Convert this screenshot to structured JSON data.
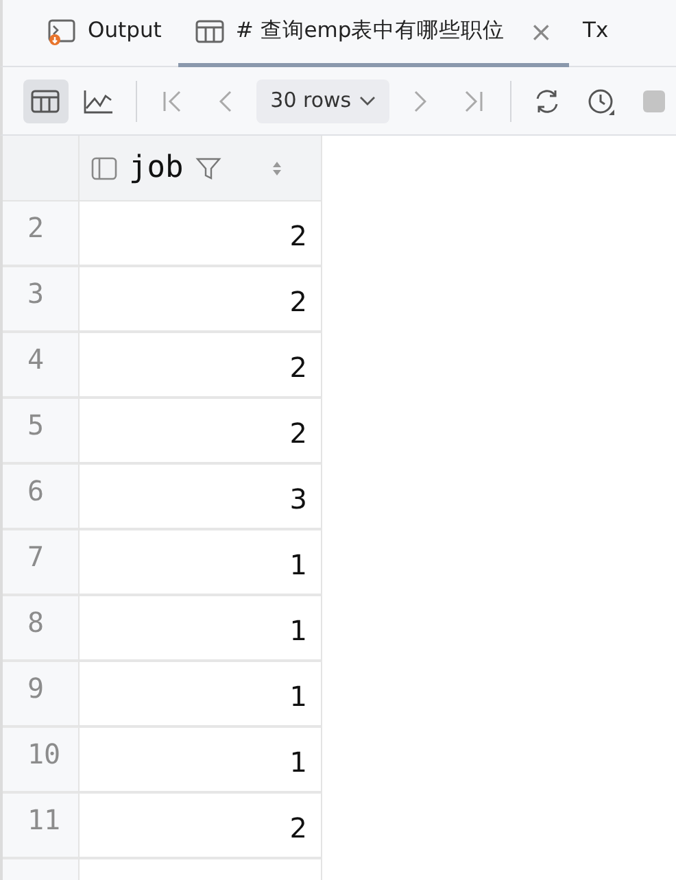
{
  "tabs": [
    {
      "kind": "output",
      "label": "Output",
      "selected": false
    },
    {
      "kind": "table",
      "label": "# 查询emp表中有哪些职位",
      "selected": true,
      "close": "×"
    },
    {
      "kind": "text",
      "label": "Tx",
      "selected": false
    }
  ],
  "toolbar": {
    "view_modes": [
      {
        "kind": "table",
        "selected": true
      },
      {
        "kind": "chart",
        "selected": false
      }
    ],
    "page_size": "30 rows"
  },
  "table": {
    "columns": [
      {
        "name": "job"
      }
    ],
    "rows": [
      {
        "number": "2",
        "job": "2"
      },
      {
        "number": "3",
        "job": "2"
      },
      {
        "number": "4",
        "job": "2"
      },
      {
        "number": "5",
        "job": "2"
      },
      {
        "number": "6",
        "job": "3"
      },
      {
        "number": "7",
        "job": "1"
      },
      {
        "number": "8",
        "job": "1"
      },
      {
        "number": "9",
        "job": "1"
      },
      {
        "number": "10",
        "job": "1"
      },
      {
        "number": "11",
        "job": "2"
      }
    ]
  }
}
